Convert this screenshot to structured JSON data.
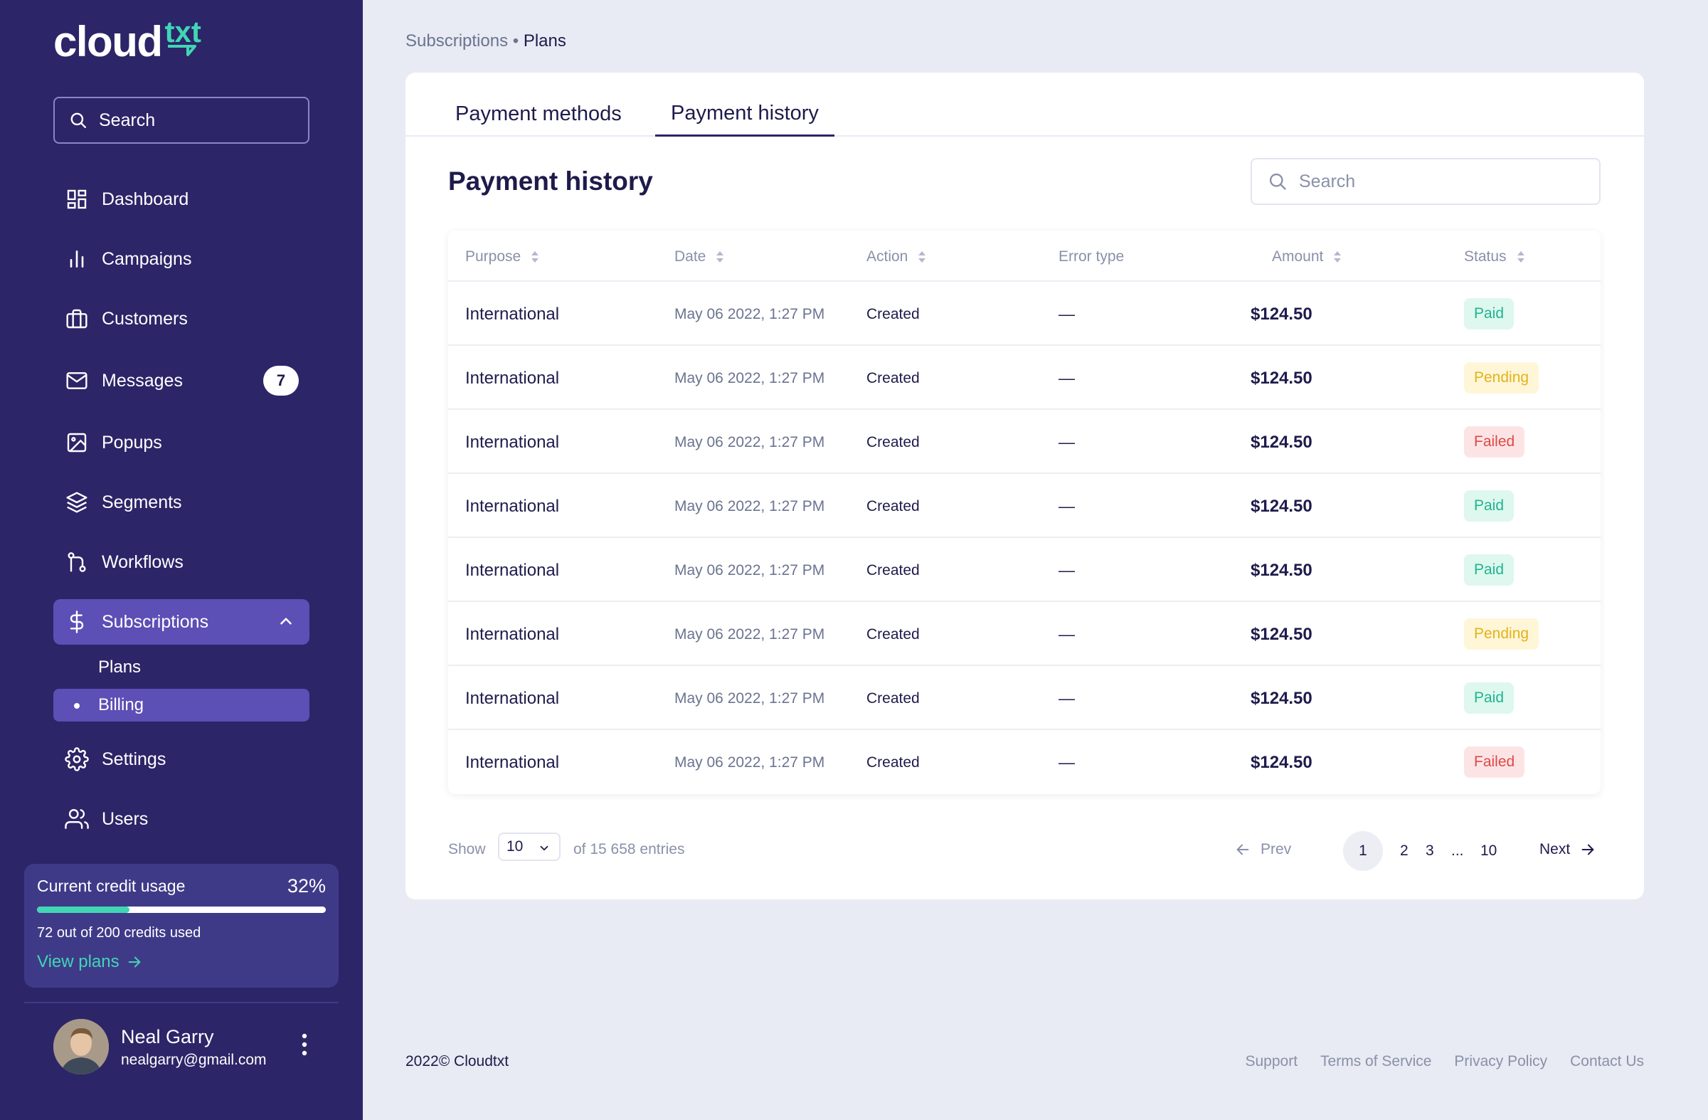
{
  "brand": {
    "name_main": "cloud",
    "name_sub": "txt",
    "accent": "#40d6b4",
    "sidebar_bg": "#2c2568"
  },
  "sidebar": {
    "search_placeholder": "Search",
    "items": [
      {
        "label": "Dashboard",
        "icon": "grid-icon"
      },
      {
        "label": "Campaigns",
        "icon": "bar-chart-icon"
      },
      {
        "label": "Customers",
        "icon": "briefcase-icon"
      },
      {
        "label": "Messages",
        "icon": "mail-icon",
        "badge": "7"
      },
      {
        "label": "Popups",
        "icon": "image-icon"
      },
      {
        "label": "Segments",
        "icon": "layers-icon"
      },
      {
        "label": "Workflows",
        "icon": "git-branch-icon"
      },
      {
        "label": "Subscriptions",
        "icon": "dollar-icon",
        "expanded": true
      },
      {
        "label": "Settings",
        "icon": "gear-icon"
      },
      {
        "label": "Users",
        "icon": "users-icon"
      }
    ],
    "sub_items": [
      {
        "label": "Plans"
      },
      {
        "label": "Billing",
        "active": true
      }
    ],
    "credit": {
      "title": "Current credit usage",
      "percent_label": "32%",
      "percent": 0.32,
      "used": "72",
      "used_text_mid": "out of",
      "total": "200",
      "used_text_end": "credits used",
      "link": "View plans"
    },
    "user": {
      "name": "Neal Garry",
      "email": "nealgarry@gmail.com"
    }
  },
  "breadcrumb": {
    "parent": "Subscriptions",
    "sep": "•",
    "current": "Plans"
  },
  "tabs": [
    {
      "label": "Payment methods",
      "active": false
    },
    {
      "label": "Payment history",
      "active": true
    }
  ],
  "content": {
    "title": "Payment history",
    "search_placeholder": "Search",
    "columns": [
      "Purpose",
      "Date",
      "Action",
      "Error type",
      "Amount",
      "Status"
    ],
    "rows": [
      {
        "purpose": "International",
        "date": "May 06 2022, 1:27 PM",
        "action": "Created",
        "error": "—",
        "amount": "$124.50",
        "status": "Paid"
      },
      {
        "purpose": "International",
        "date": "May 06 2022, 1:27 PM",
        "action": "Created",
        "error": "—",
        "amount": "$124.50",
        "status": "Pending"
      },
      {
        "purpose": "International",
        "date": "May 06 2022, 1:27 PM",
        "action": "Created",
        "error": "—",
        "amount": "$124.50",
        "status": "Failed"
      },
      {
        "purpose": "International",
        "date": "May 06 2022, 1:27 PM",
        "action": "Created",
        "error": "—",
        "amount": "$124.50",
        "status": "Paid"
      },
      {
        "purpose": "International",
        "date": "May 06 2022, 1:27 PM",
        "action": "Created",
        "error": "—",
        "amount": "$124.50",
        "status": "Paid"
      },
      {
        "purpose": "International",
        "date": "May 06 2022, 1:27 PM",
        "action": "Created",
        "error": "—",
        "amount": "$124.50",
        "status": "Pending"
      },
      {
        "purpose": "International",
        "date": "May 06 2022, 1:27 PM",
        "action": "Created",
        "error": "—",
        "amount": "$124.50",
        "status": "Paid"
      },
      {
        "purpose": "International",
        "date": "May 06 2022, 1:27 PM",
        "action": "Created",
        "error": "—",
        "amount": "$124.50",
        "status": "Failed"
      }
    ],
    "status_colors": {
      "Paid": "#1fb58d",
      "Pending": "#e3b21a",
      "Failed": "#e04848"
    }
  },
  "pagination": {
    "show_label": "Show",
    "page_size": "10",
    "entries_text": "of 15 658 entries",
    "prev": "Prev",
    "pages": [
      "1",
      "2",
      "3",
      "...",
      "10"
    ],
    "current": "1",
    "next": "Next"
  },
  "footer": {
    "copyright": "2022© Cloudtxt",
    "links": [
      "Support",
      "Terms of Service",
      "Privacy Policy",
      "Contact Us"
    ]
  }
}
